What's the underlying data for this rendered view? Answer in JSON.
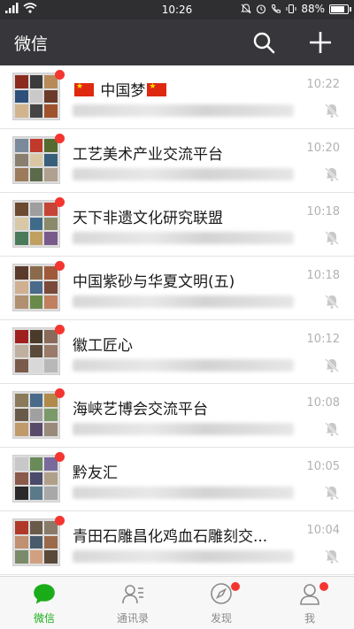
{
  "status_bar": {
    "time": "10:26",
    "battery": "88%",
    "battery_level": 0.88
  },
  "header": {
    "title": "微信",
    "icons": [
      "search-icon",
      "add-icon"
    ]
  },
  "chats": [
    {
      "name_prefix_flag": true,
      "name": "中国梦",
      "name_suffix_flag": true,
      "time": "10:22",
      "unread": true,
      "muted": true,
      "avatar_colors": [
        "#8b2b1e",
        "#3b3b3b",
        "#b88a5a",
        "#2d4f7a",
        "#c9c9c9",
        "#6b3a2a",
        "#d2b48c",
        "#444",
        "#a0522d"
      ]
    },
    {
      "name": "工艺美术产业交流平台",
      "time": "10:20",
      "unread": true,
      "muted": true,
      "avatar_colors": [
        "#7a8a9a",
        "#c0392b",
        "#556b2f",
        "#8a7f6e",
        "#d9c7a3",
        "#3a5f7a",
        "#9b7b5b",
        "#5a6a4a",
        "#b0a090"
      ]
    },
    {
      "name": "天下非遗文化研究联盟",
      "time": "10:18",
      "unread": true,
      "muted": true,
      "avatar_colors": [
        "#6b4a2f",
        "#9e9e9e",
        "#c44536",
        "#d8c8a8",
        "#3f6b8a",
        "#8a8a6a",
        "#4a7a5a",
        "#c0a060",
        "#7a5a8a"
      ]
    },
    {
      "name": "中国紫砂与华夏文明(五)",
      "time": "10:18",
      "unread": true,
      "muted": true,
      "avatar_colors": [
        "#5a3a2a",
        "#8a6a4a",
        "#a05a3a",
        "#d0b090",
        "#4a6a8a",
        "#7a4a3a",
        "#b09070",
        "#6a8a4a",
        "#c08060"
      ]
    },
    {
      "name": "徽工匠心",
      "time": "10:12",
      "unread": true,
      "muted": true,
      "avatar_colors": [
        "#a02020",
        "#4a3a2a",
        "#8a6a5a",
        "#c0b0a0",
        "#5a4a3a",
        "#9a7a6a",
        "#7a5a4a",
        "#d8d8d8",
        "#b8b8b8"
      ]
    },
    {
      "name": "海峡艺博会交流平台",
      "time": "10:08",
      "unread": true,
      "muted": true,
      "avatar_colors": [
        "#8a7a5a",
        "#4a6a8a",
        "#b08a4a",
        "#6a5a4a",
        "#a0a0a0",
        "#7a9a6a",
        "#c09a6a",
        "#5a4a6a",
        "#9a8a7a"
      ]
    },
    {
      "name": "黔友汇",
      "time": "10:05",
      "unread": true,
      "muted": true,
      "avatar_colors": [
        "#c8c8c8",
        "#6a8a5a",
        "#7a6a9a",
        "#8a5a4a",
        "#4a4a6a",
        "#b0a08a",
        "#2a2a2a",
        "#5a7a8a",
        "#a8a8a8"
      ]
    },
    {
      "name": "青田石雕昌化鸡血石雕刻交...",
      "time": "10:04",
      "unread": true,
      "muted": true,
      "avatar_colors": [
        "#b03a2a",
        "#6a5a4a",
        "#8a7a6a",
        "#c09070",
        "#4a5a6a",
        "#9a6a4a",
        "#7a8a6a",
        "#d0a080",
        "#5a4a3a"
      ]
    }
  ],
  "tabs": [
    {
      "label": "微信",
      "icon": "chat-bubble-icon",
      "active": true,
      "badge": false
    },
    {
      "label": "通讯录",
      "icon": "contacts-icon",
      "active": false,
      "badge": false
    },
    {
      "label": "发现",
      "icon": "compass-icon",
      "active": false,
      "badge": true
    },
    {
      "label": "我",
      "icon": "person-icon",
      "active": false,
      "badge": true
    }
  ],
  "colors": {
    "header_bg": "#37373b",
    "status_bg": "#2f2f32",
    "accent_green": "#1aad19",
    "badge_red": "#f43530"
  }
}
